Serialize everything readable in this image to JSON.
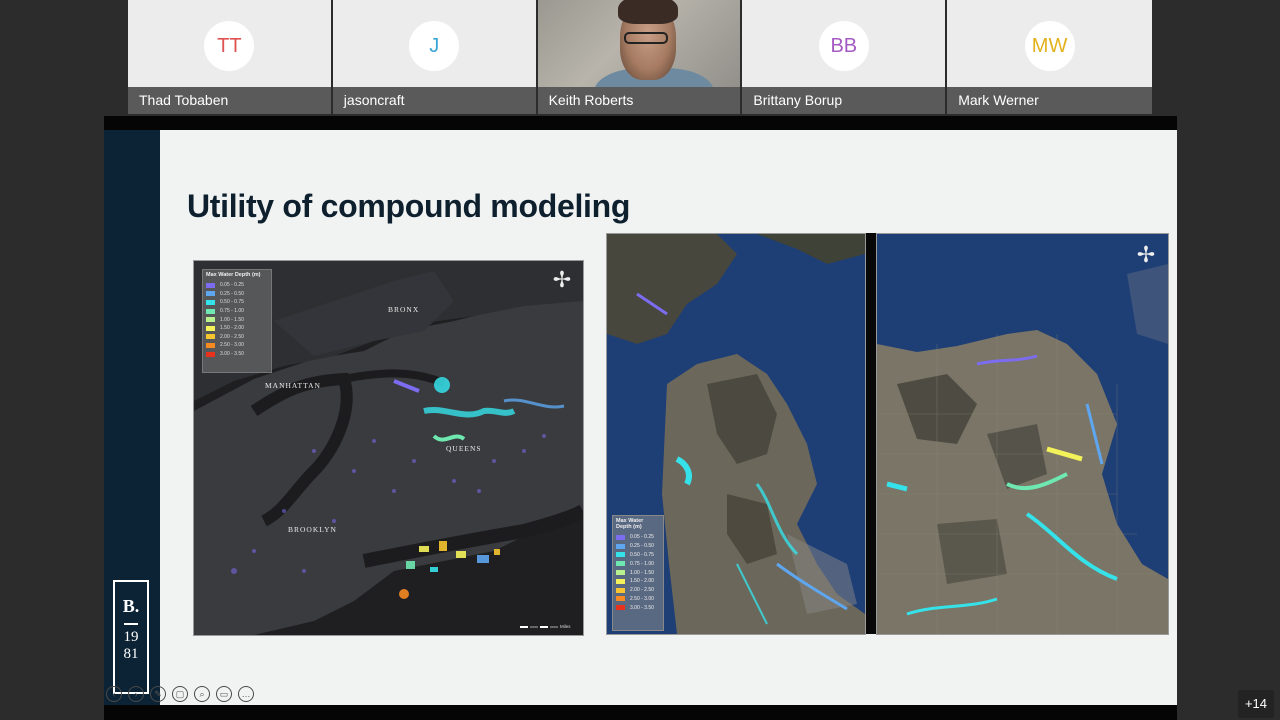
{
  "participants": [
    {
      "initials": "TT",
      "name": "Thad Tobaben",
      "color": "#e05252"
    },
    {
      "initials": "J",
      "name": "jasoncraft",
      "color": "#3aa3d6"
    },
    {
      "initials": "",
      "name": "Keith Roberts",
      "color": ""
    },
    {
      "initials": "BB",
      "name": "Brittany Borup",
      "color": "#a45ac2"
    },
    {
      "initials": "MW",
      "name": "Mark Werner",
      "color": "#e2b21c"
    }
  ],
  "slide": {
    "title": "Utility of compound modeling",
    "brand": {
      "letter": "B.",
      "year_top": "19",
      "year_bottom": "81"
    },
    "nyc_map": {
      "legend_title": "Max Water Depth (m)",
      "legend": [
        {
          "range": "0.05 - 0.25",
          "color": "#7b6cf0"
        },
        {
          "range": "0.25 - 0.50",
          "color": "#5ea6ef"
        },
        {
          "range": "0.50 - 0.75",
          "color": "#36e2ea"
        },
        {
          "range": "0.75 - 1.00",
          "color": "#6ee8b0"
        },
        {
          "range": "1.00 - 1.50",
          "color": "#b8f090"
        },
        {
          "range": "1.50 - 2.00",
          "color": "#f4f25a"
        },
        {
          "range": "2.00 - 2.50",
          "color": "#f7c530"
        },
        {
          "range": "2.50 - 3.00",
          "color": "#f58a22"
        },
        {
          "range": "3.00 - 3.50",
          "color": "#e8321e"
        }
      ],
      "labels": {
        "bronx": "BRONX",
        "manhattan": "MANHATTAN",
        "queens": "QUEENS",
        "brooklyn": "BROOKLYN"
      },
      "scale_unit": "Miles"
    },
    "sf_map": {
      "legend_title": "Max Water Depth (m)",
      "legend": [
        {
          "range": "0.05 - 0.25",
          "color": "#7b6cf0"
        },
        {
          "range": "0.25 - 0.50",
          "color": "#5ea6ef"
        },
        {
          "range": "0.50 - 0.75",
          "color": "#36e2ea"
        },
        {
          "range": "0.75 - 1.00",
          "color": "#6ee8b0"
        },
        {
          "range": "1.00 - 1.50",
          "color": "#b8f090"
        },
        {
          "range": "1.50 - 2.00",
          "color": "#f4f25a"
        },
        {
          "range": "2.00 - 2.50",
          "color": "#f7c530"
        },
        {
          "range": "2.50 - 3.00",
          "color": "#f58a22"
        },
        {
          "range": "3.00 - 3.50",
          "color": "#e8321e"
        }
      ]
    }
  },
  "more_participants": "+14"
}
